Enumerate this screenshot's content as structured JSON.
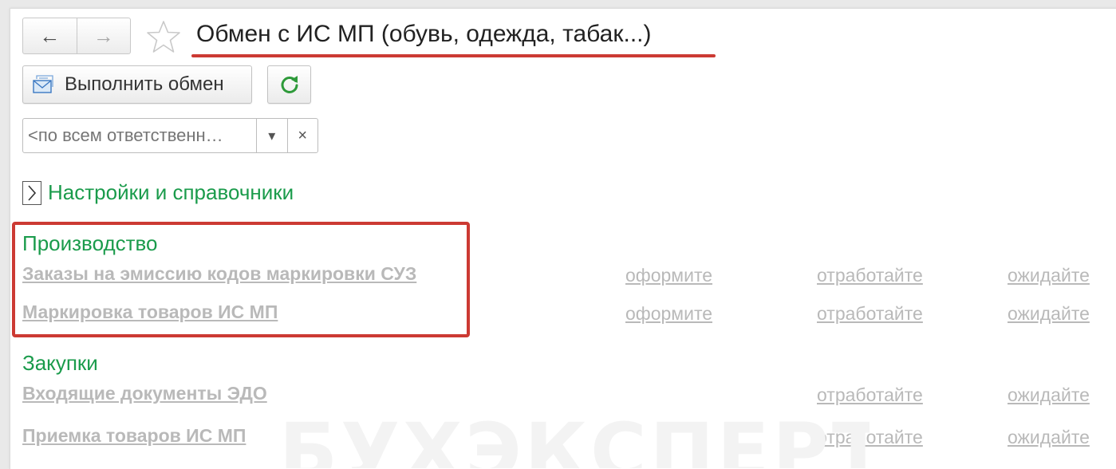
{
  "window": {
    "title": "Обмен с ИС МП (обувь, одежда, табак...)",
    "nav": {
      "back_icon": "←",
      "forward_icon": "→"
    },
    "favorite_icon": "star-outline-icon"
  },
  "toolbar": {
    "exchange_label": "Выполнить обмен",
    "refresh_icon": "refresh-icon"
  },
  "filter": {
    "responsible_placeholder": "<по всем ответственн…",
    "dropdown_icon": "▾",
    "clear_icon": "×"
  },
  "settings_group": {
    "label": "Настройки и справочники",
    "chevron_icon": "chevron-right-icon"
  },
  "sections": [
    {
      "title": "Производство",
      "rows": [
        {
          "label": "Заказы на эмиссию кодов маркировки СУЗ",
          "statuses": [
            "оформите",
            "отработайте",
            "ожидайте"
          ]
        },
        {
          "label": "Маркировка товаров ИС МП",
          "statuses": [
            "оформите",
            "отработайте",
            "ожидайте"
          ]
        }
      ]
    },
    {
      "title": "Закупки",
      "rows": [
        {
          "label": "Входящие документы ЭДО",
          "statuses": [
            "",
            "отработайте",
            "ожидайте"
          ]
        },
        {
          "label": "Приемка товаров ИС МП",
          "statuses": [
            "",
            "отработайте",
            "ожидайте"
          ]
        }
      ]
    }
  ],
  "watermark": {
    "text": "БУХЭКСПЕРТ"
  },
  "colors": {
    "accent_green": "#1a9b4b",
    "annotation_red": "#cc3a33",
    "inactive_link_gray": "#b9b9b9"
  }
}
